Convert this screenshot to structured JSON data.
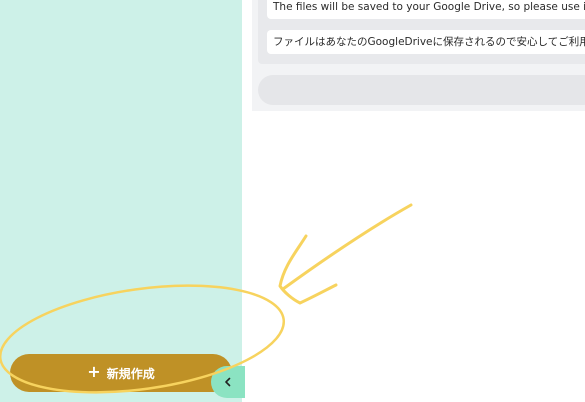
{
  "sidebar": {
    "new_button_label": "新規作成",
    "new_button_icon": "plus-icon",
    "collapse_icon": "chevron-left-icon"
  },
  "chat": {
    "messages": [
      "The files will be saved to your Google Drive, so please use it with co",
      "ファイルはあなたのGoogleDriveに保存されるので安心してご利用くだ"
    ],
    "input_placeholder": ""
  },
  "colors": {
    "sidebar_bg": "#cdf1e8",
    "new_button_bg": "#bf9126",
    "collapse_tab_bg": "#8be3c2",
    "annotation_stroke": "#f7d35e"
  }
}
